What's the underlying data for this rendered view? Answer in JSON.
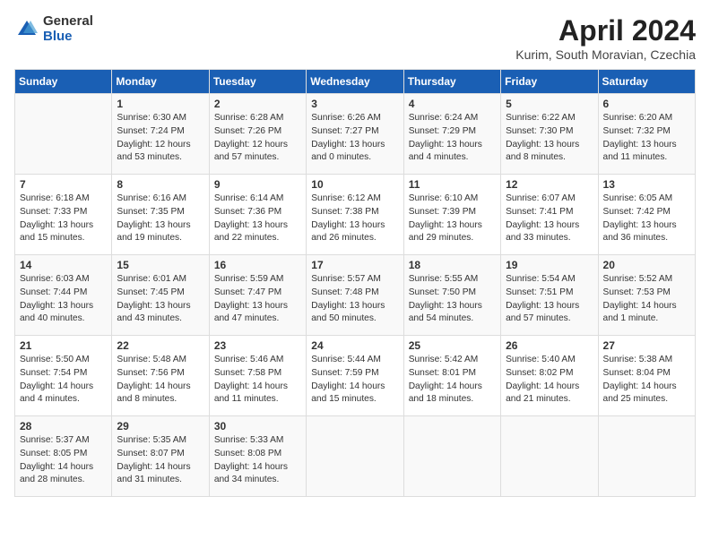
{
  "logo": {
    "general": "General",
    "blue": "Blue"
  },
  "title": "April 2024",
  "location": "Kurim, South Moravian, Czechia",
  "days_of_week": [
    "Sunday",
    "Monday",
    "Tuesday",
    "Wednesday",
    "Thursday",
    "Friday",
    "Saturday"
  ],
  "weeks": [
    [
      {
        "day": "",
        "info": ""
      },
      {
        "day": "1",
        "info": "Sunrise: 6:30 AM\nSunset: 7:24 PM\nDaylight: 12 hours\nand 53 minutes."
      },
      {
        "day": "2",
        "info": "Sunrise: 6:28 AM\nSunset: 7:26 PM\nDaylight: 12 hours\nand 57 minutes."
      },
      {
        "day": "3",
        "info": "Sunrise: 6:26 AM\nSunset: 7:27 PM\nDaylight: 13 hours\nand 0 minutes."
      },
      {
        "day": "4",
        "info": "Sunrise: 6:24 AM\nSunset: 7:29 PM\nDaylight: 13 hours\nand 4 minutes."
      },
      {
        "day": "5",
        "info": "Sunrise: 6:22 AM\nSunset: 7:30 PM\nDaylight: 13 hours\nand 8 minutes."
      },
      {
        "day": "6",
        "info": "Sunrise: 6:20 AM\nSunset: 7:32 PM\nDaylight: 13 hours\nand 11 minutes."
      }
    ],
    [
      {
        "day": "7",
        "info": "Sunrise: 6:18 AM\nSunset: 7:33 PM\nDaylight: 13 hours\nand 15 minutes."
      },
      {
        "day": "8",
        "info": "Sunrise: 6:16 AM\nSunset: 7:35 PM\nDaylight: 13 hours\nand 19 minutes."
      },
      {
        "day": "9",
        "info": "Sunrise: 6:14 AM\nSunset: 7:36 PM\nDaylight: 13 hours\nand 22 minutes."
      },
      {
        "day": "10",
        "info": "Sunrise: 6:12 AM\nSunset: 7:38 PM\nDaylight: 13 hours\nand 26 minutes."
      },
      {
        "day": "11",
        "info": "Sunrise: 6:10 AM\nSunset: 7:39 PM\nDaylight: 13 hours\nand 29 minutes."
      },
      {
        "day": "12",
        "info": "Sunrise: 6:07 AM\nSunset: 7:41 PM\nDaylight: 13 hours\nand 33 minutes."
      },
      {
        "day": "13",
        "info": "Sunrise: 6:05 AM\nSunset: 7:42 PM\nDaylight: 13 hours\nand 36 minutes."
      }
    ],
    [
      {
        "day": "14",
        "info": "Sunrise: 6:03 AM\nSunset: 7:44 PM\nDaylight: 13 hours\nand 40 minutes."
      },
      {
        "day": "15",
        "info": "Sunrise: 6:01 AM\nSunset: 7:45 PM\nDaylight: 13 hours\nand 43 minutes."
      },
      {
        "day": "16",
        "info": "Sunrise: 5:59 AM\nSunset: 7:47 PM\nDaylight: 13 hours\nand 47 minutes."
      },
      {
        "day": "17",
        "info": "Sunrise: 5:57 AM\nSunset: 7:48 PM\nDaylight: 13 hours\nand 50 minutes."
      },
      {
        "day": "18",
        "info": "Sunrise: 5:55 AM\nSunset: 7:50 PM\nDaylight: 13 hours\nand 54 minutes."
      },
      {
        "day": "19",
        "info": "Sunrise: 5:54 AM\nSunset: 7:51 PM\nDaylight: 13 hours\nand 57 minutes."
      },
      {
        "day": "20",
        "info": "Sunrise: 5:52 AM\nSunset: 7:53 PM\nDaylight: 14 hours\nand 1 minute."
      }
    ],
    [
      {
        "day": "21",
        "info": "Sunrise: 5:50 AM\nSunset: 7:54 PM\nDaylight: 14 hours\nand 4 minutes."
      },
      {
        "day": "22",
        "info": "Sunrise: 5:48 AM\nSunset: 7:56 PM\nDaylight: 14 hours\nand 8 minutes."
      },
      {
        "day": "23",
        "info": "Sunrise: 5:46 AM\nSunset: 7:58 PM\nDaylight: 14 hours\nand 11 minutes."
      },
      {
        "day": "24",
        "info": "Sunrise: 5:44 AM\nSunset: 7:59 PM\nDaylight: 14 hours\nand 15 minutes."
      },
      {
        "day": "25",
        "info": "Sunrise: 5:42 AM\nSunset: 8:01 PM\nDaylight: 14 hours\nand 18 minutes."
      },
      {
        "day": "26",
        "info": "Sunrise: 5:40 AM\nSunset: 8:02 PM\nDaylight: 14 hours\nand 21 minutes."
      },
      {
        "day": "27",
        "info": "Sunrise: 5:38 AM\nSunset: 8:04 PM\nDaylight: 14 hours\nand 25 minutes."
      }
    ],
    [
      {
        "day": "28",
        "info": "Sunrise: 5:37 AM\nSunset: 8:05 PM\nDaylight: 14 hours\nand 28 minutes."
      },
      {
        "day": "29",
        "info": "Sunrise: 5:35 AM\nSunset: 8:07 PM\nDaylight: 14 hours\nand 31 minutes."
      },
      {
        "day": "30",
        "info": "Sunrise: 5:33 AM\nSunset: 8:08 PM\nDaylight: 14 hours\nand 34 minutes."
      },
      {
        "day": "",
        "info": ""
      },
      {
        "day": "",
        "info": ""
      },
      {
        "day": "",
        "info": ""
      },
      {
        "day": "",
        "info": ""
      }
    ]
  ]
}
